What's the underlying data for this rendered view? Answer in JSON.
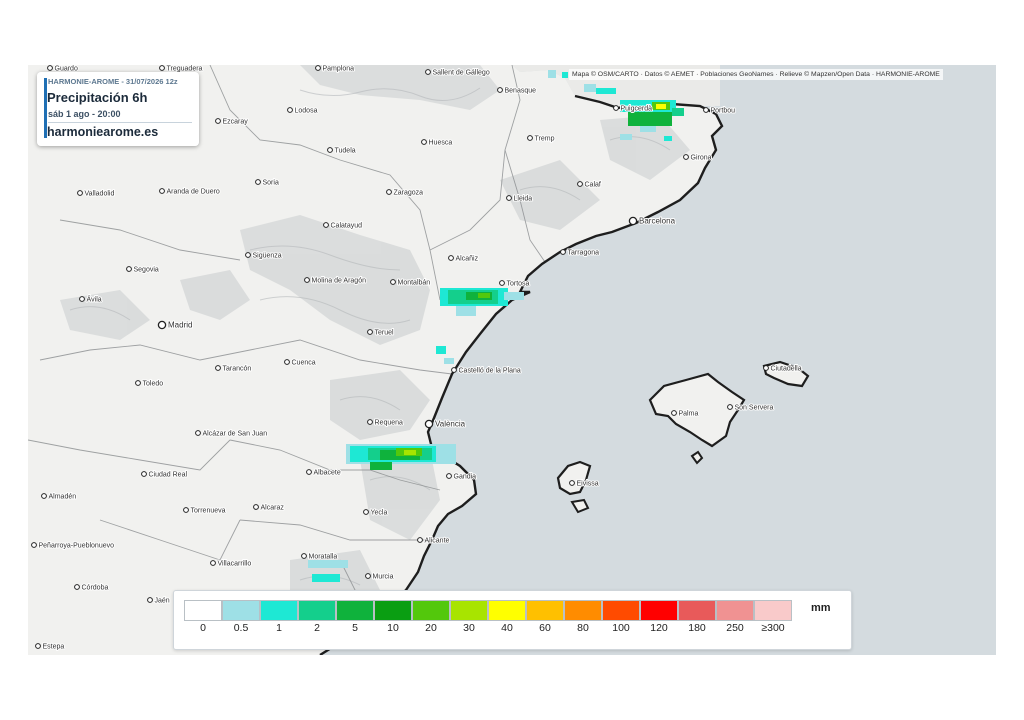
{
  "infobox": {
    "model_run": "HARMONIE-AROME - 31/07/2026 12z",
    "title": "Precipitación 6h",
    "valid_time": "sáb 1 ago - 20:00",
    "site": "harmoniearome.es"
  },
  "attribution": "Mapa © OSM/CARTO · Datos © AEMET · Poblaciones GeoNames · Relieve © Mapzen/Open Data · HARMONIE-AROME",
  "legend": {
    "unit": "mm",
    "items": [
      {
        "label": "0",
        "color": "#ffffff"
      },
      {
        "label": "0.5",
        "color": "#9ee0e6"
      },
      {
        "label": "1",
        "color": "#1ee8d4"
      },
      {
        "label": "2",
        "color": "#14cf8c"
      },
      {
        "label": "5",
        "color": "#0fb23c"
      },
      {
        "label": "10",
        "color": "#0a9e12"
      },
      {
        "label": "20",
        "color": "#53c80c"
      },
      {
        "label": "30",
        "color": "#a8e400"
      },
      {
        "label": "40",
        "color": "#ffff00"
      },
      {
        "label": "60",
        "color": "#ffc000"
      },
      {
        "label": "80",
        "color": "#ff8c00"
      },
      {
        "label": "100",
        "color": "#ff4b00"
      },
      {
        "label": "120",
        "color": "#ff0000"
      },
      {
        "label": "180",
        "color": "#e85a5a"
      },
      {
        "label": "250",
        "color": "#f09292"
      },
      {
        "label": "≥300",
        "color": "#f9caca"
      }
    ]
  },
  "cities": [
    {
      "name": "Pamplona"
    },
    {
      "name": "Sallent de Gállego"
    },
    {
      "name": "Benasque"
    },
    {
      "name": "Puigcerdà"
    },
    {
      "name": "Portbou"
    },
    {
      "name": "Ezcaray"
    },
    {
      "name": "Lodosa"
    },
    {
      "name": "Tudela"
    },
    {
      "name": "Huesca"
    },
    {
      "name": "Tremp"
    },
    {
      "name": "Girona"
    },
    {
      "name": "Valladolid"
    },
    {
      "name": "Aranda de Duero"
    },
    {
      "name": "Soria"
    },
    {
      "name": "Zaragoza"
    },
    {
      "name": "Lleida"
    },
    {
      "name": "Calaf"
    },
    {
      "name": "Barcelona"
    },
    {
      "name": "Calatayud"
    },
    {
      "name": "Sigüenza"
    },
    {
      "name": "Alcañiz"
    },
    {
      "name": "Tarragona"
    },
    {
      "name": "Segovia"
    },
    {
      "name": "Molina de Aragón"
    },
    {
      "name": "Montalbán"
    },
    {
      "name": "Tortosa"
    },
    {
      "name": "Ávila"
    },
    {
      "name": "Madrid"
    },
    {
      "name": "Teruel"
    },
    {
      "name": "Tarancón"
    },
    {
      "name": "Cuenca"
    },
    {
      "name": "Castelló de la Plana"
    },
    {
      "name": "Ciutadella"
    },
    {
      "name": "Toledo"
    },
    {
      "name": "Palma"
    },
    {
      "name": "Son Servera"
    },
    {
      "name": "Requena"
    },
    {
      "name": "València"
    },
    {
      "name": "Alcázar de San Juan"
    },
    {
      "name": "Ciudad Real"
    },
    {
      "name": "Albacete"
    },
    {
      "name": "Gandia"
    },
    {
      "name": "Eivissa"
    },
    {
      "name": "Almadén"
    },
    {
      "name": "Torrenueva"
    },
    {
      "name": "Alcaraz"
    },
    {
      "name": "Yecla"
    },
    {
      "name": "Peñarroya-Pueblonuevo"
    },
    {
      "name": "Alicante"
    },
    {
      "name": "Moratalla"
    },
    {
      "name": "Villacarrillo"
    },
    {
      "name": "Murcia"
    },
    {
      "name": "Córdoba"
    },
    {
      "name": "Jaén"
    },
    {
      "name": "Estepa"
    },
    {
      "name": "Guardo"
    },
    {
      "name": "Treguadera"
    }
  ]
}
